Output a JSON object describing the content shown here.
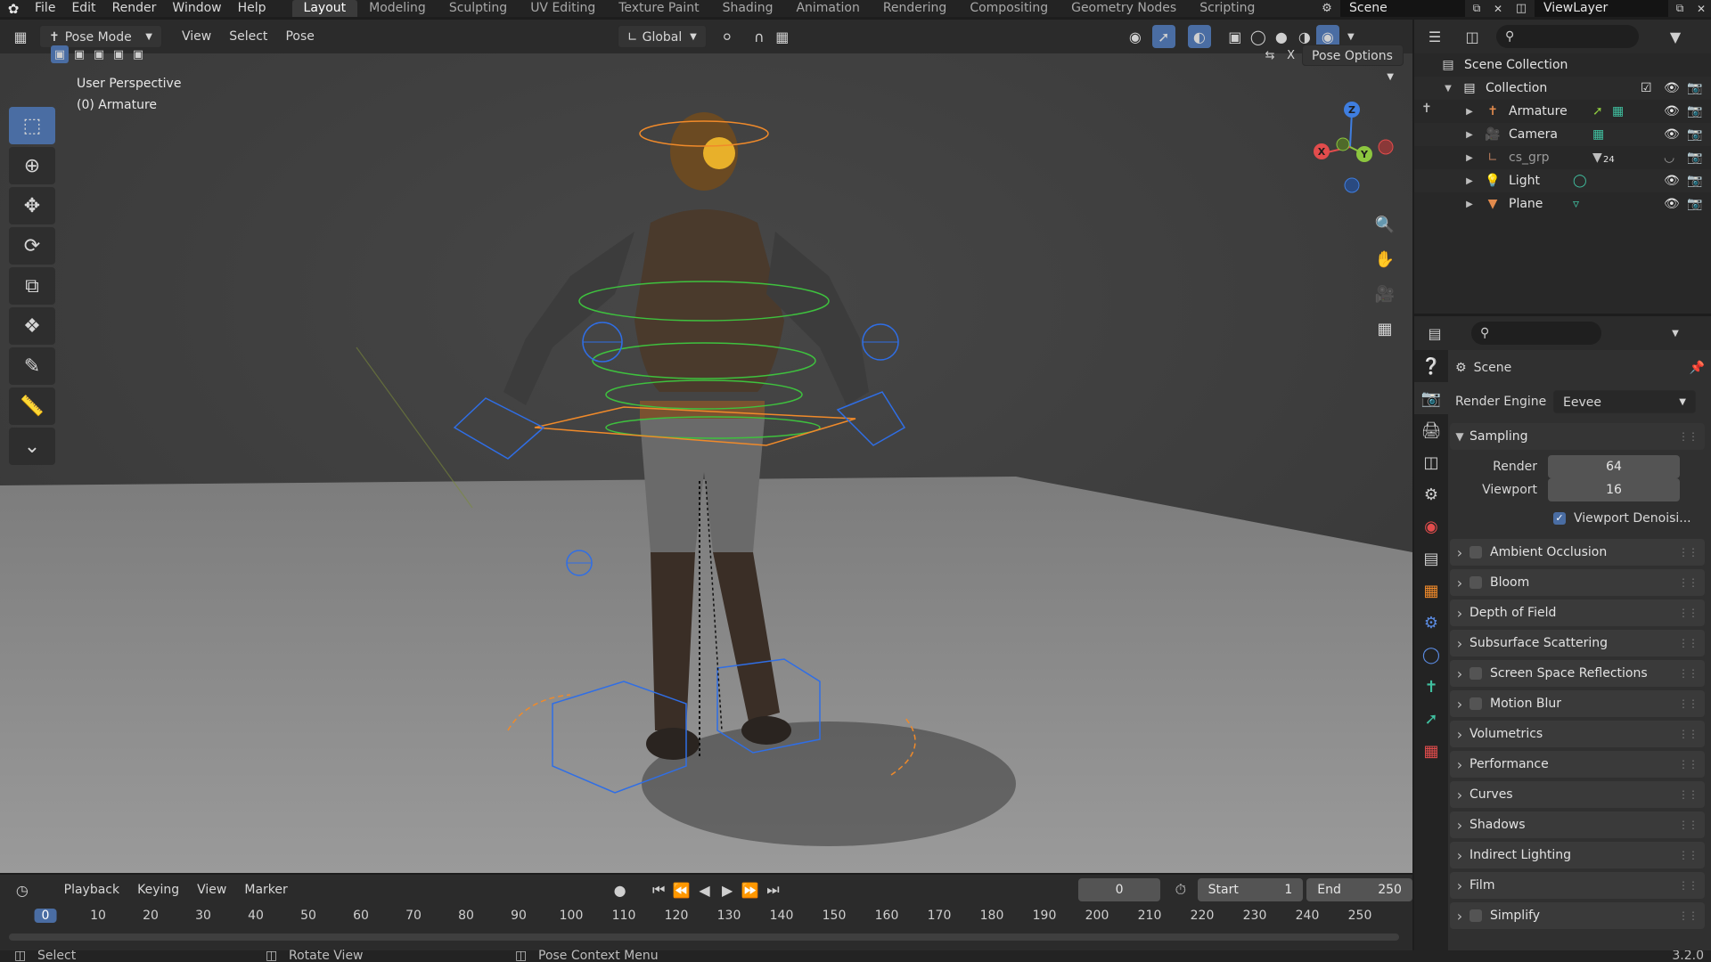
{
  "top_bar": {
    "menus": [
      "File",
      "Edit",
      "Render",
      "Window",
      "Help"
    ],
    "workspace_tabs": [
      "Layout",
      "Modeling",
      "Sculpting",
      "UV Editing",
      "Texture Paint",
      "Shading",
      "Animation",
      "Rendering",
      "Compositing",
      "Geometry Nodes",
      "Scripting"
    ],
    "active_tab": "Layout",
    "scene_name": "Scene",
    "view_layer": "ViewLayer"
  },
  "viewport": {
    "mode": "Pose Mode",
    "menus": [
      "View",
      "Select",
      "Pose"
    ],
    "orientation": "Global",
    "options_label": "Pose Options",
    "close_label": "X",
    "perspective_label": "User Perspective",
    "object_label": "(0) Armature",
    "gizmo_axes": {
      "x": "X",
      "y": "Y",
      "z": "Z"
    },
    "colors": {
      "background": "#3d3d3d",
      "floor": "#8a8a8a",
      "axis_x": "#e24c4c",
      "axis_y": "#8cc63f",
      "axis_z": "#3f7ee0",
      "bone_blue": "#2f6ee6",
      "bone_green": "#3ec13e",
      "bone_orange": "#f08a2a"
    },
    "tools": [
      "select-box-icon",
      "cursor-icon",
      "move-icon",
      "rotate-icon",
      "scale-icon",
      "transform-icon",
      "annotate-icon",
      "measure-icon",
      "breakdowner-icon"
    ]
  },
  "timeline": {
    "menus": [
      "Playback",
      "Keying",
      "View",
      "Marker"
    ],
    "current_frame": "0",
    "start_label": "Start",
    "start": "1",
    "end_label": "End",
    "end": "250",
    "ruler": [
      "0",
      "10",
      "20",
      "30",
      "40",
      "50",
      "60",
      "70",
      "80",
      "90",
      "100",
      "110",
      "120",
      "130",
      "140",
      "150",
      "160",
      "170",
      "180",
      "190",
      "200",
      "210",
      "220",
      "230",
      "240",
      "250"
    ]
  },
  "status_bar": {
    "items": [
      "Select",
      "Rotate View",
      "Pose Context Menu"
    ],
    "version": "3.2.0"
  },
  "outliner": {
    "root": "Scene Collection",
    "collection": "Collection",
    "objects": [
      {
        "name": "Armature",
        "icon": "armature-icon",
        "color": "#e38b4d"
      },
      {
        "name": "Camera",
        "icon": "camera-icon",
        "color": "#e38b4d"
      },
      {
        "name": "cs_grp",
        "icon": "empty-icon",
        "color": "#e38b4d",
        "badge": "24"
      },
      {
        "name": "Light",
        "icon": "light-icon",
        "color": "#e38b4d"
      },
      {
        "name": "Plane",
        "icon": "mesh-icon",
        "color": "#e38b4d"
      }
    ]
  },
  "properties": {
    "title": "Scene",
    "render_engine_label": "Render Engine",
    "render_engine": "Eevee",
    "sampling": {
      "title": "Sampling",
      "render_label": "Render",
      "render_value": "64",
      "viewport_label": "Viewport",
      "viewport_value": "16",
      "denoise_label": "Viewport Denoisi..."
    },
    "panels": [
      {
        "name": "Ambient Occlusion",
        "checkbox": true
      },
      {
        "name": "Bloom",
        "checkbox": true
      },
      {
        "name": "Depth of Field",
        "checkbox": false
      },
      {
        "name": "Subsurface Scattering",
        "checkbox": false
      },
      {
        "name": "Screen Space Reflections",
        "checkbox": true
      },
      {
        "name": "Motion Blur",
        "checkbox": true
      },
      {
        "name": "Volumetrics",
        "checkbox": false
      },
      {
        "name": "Performance",
        "checkbox": false
      },
      {
        "name": "Curves",
        "checkbox": false
      },
      {
        "name": "Shadows",
        "checkbox": false
      },
      {
        "name": "Indirect Lighting",
        "checkbox": false
      },
      {
        "name": "Film",
        "checkbox": false
      },
      {
        "name": "Simplify",
        "checkbox": true
      }
    ]
  }
}
